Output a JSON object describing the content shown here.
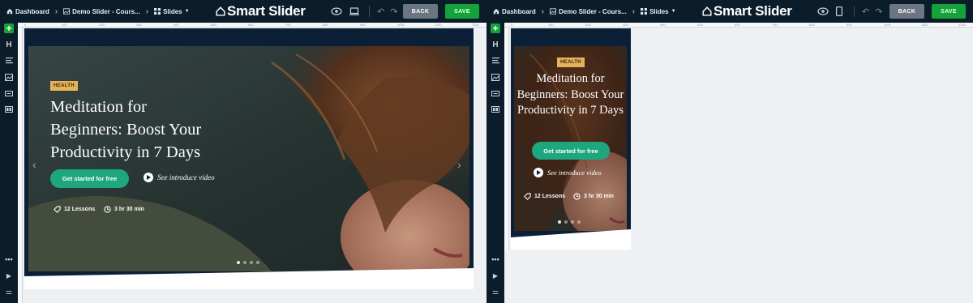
{
  "breadcrumb": {
    "dashboard": "Dashboard",
    "slider": "Demo Slider - Cours...",
    "slides": "Slides"
  },
  "brand": {
    "name": "Smart Slider"
  },
  "toolbar": {
    "back_label": "BACK",
    "save_label": "SAVE"
  },
  "slide": {
    "tag": "HEALTH",
    "heading_line1": "Meditation for",
    "heading_line2": "Beginners: Boost Your",
    "heading_line3": "Productivity in 7 Days",
    "cta": "Get started for free",
    "video": "See introduce video",
    "lessons": "12 Lessons",
    "duration": "3 hr 30 min"
  },
  "ruler_labels": [
    "0",
    "100",
    "200",
    "300",
    "400",
    "500",
    "600",
    "700",
    "800",
    "900",
    "1000",
    "1100",
    "1200"
  ],
  "colors": {
    "topbar": "#0b1c2a",
    "save": "#13a33a",
    "tag": "#e4b35a",
    "cta": "#1ea77f"
  }
}
